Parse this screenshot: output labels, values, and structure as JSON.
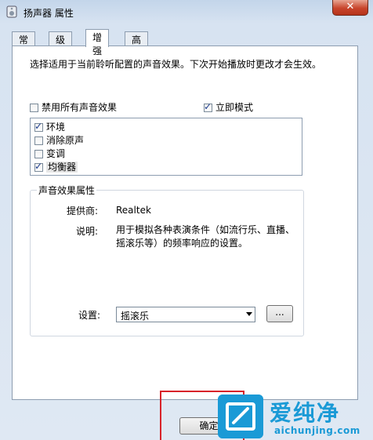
{
  "window": {
    "title": "扬声器 属性",
    "close_label": "✕"
  },
  "tabs": [
    {
      "label": "常规"
    },
    {
      "label": "级别"
    },
    {
      "label": "增强"
    },
    {
      "label": "高级"
    }
  ],
  "content": {
    "description": "选择适用于当前聆听配置的声音效果。下次开始播放时更改才会生效。",
    "disable_all": {
      "label": "禁用所有声音效果",
      "checked": false
    },
    "immediate_mode": {
      "label": "立即模式",
      "checked": true
    },
    "effects": [
      {
        "label": "环境",
        "checked": true
      },
      {
        "label": "消除原声",
        "checked": false
      },
      {
        "label": "变调",
        "checked": false
      },
      {
        "label": "均衡器",
        "checked": true
      }
    ],
    "properties": {
      "title": "声音效果属性",
      "provider_key": "提供商:",
      "provider_value": "Realtek",
      "desc_key": "说明:",
      "desc_value": "用于模拟各种表演条件（如流行乐、直播、摇滚乐等）的频率响应的设置。",
      "setting_key": "设置:",
      "setting_value": "摇滚乐",
      "more_label": "..."
    }
  },
  "footer": {
    "ok_label": "确定"
  },
  "watermark": {
    "text": "爱纯净",
    "url": "aichunjing.com"
  },
  "colors": {
    "highlight_box": "#d8232a",
    "watermark": "#1a9ad6"
  }
}
